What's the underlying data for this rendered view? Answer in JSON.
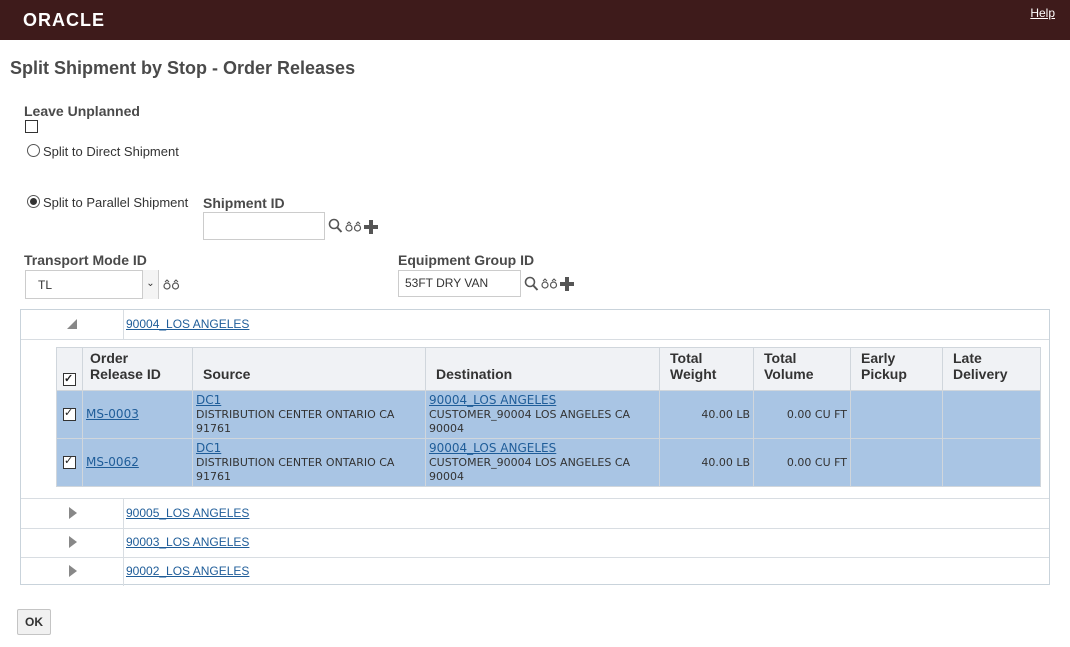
{
  "header": {
    "logo": "ORACLE",
    "help": "Help"
  },
  "page_title": "Split Shipment by Stop - Order Releases",
  "form": {
    "leave_unplanned_label": "Leave Unplanned",
    "leave_unplanned_checked": false,
    "split_direct_label": "Split to Direct Shipment",
    "split_parallel_label": "Split to Parallel Shipment",
    "selected_option": "split_parallel",
    "shipment_id_label": "Shipment ID",
    "shipment_id_value": "",
    "transport_mode_label": "Transport Mode ID",
    "transport_mode_value": "TL",
    "equipment_group_label": "Equipment Group ID",
    "equipment_group_value": "53FT DRY VAN"
  },
  "groups": [
    {
      "name": "90004_LOS ANGELES",
      "expanded": true
    },
    {
      "name": "90005_LOS ANGELES",
      "expanded": false
    },
    {
      "name": "90003_LOS ANGELES",
      "expanded": false
    },
    {
      "name": "90002_LOS ANGELES",
      "expanded": false
    }
  ],
  "table": {
    "headers": {
      "order_release_id": "Order Release ID",
      "source": "Source",
      "destination": "Destination",
      "total_weight": "Total Weight",
      "total_volume": "Total Volume",
      "early_pickup": "Early Pickup",
      "late_delivery": "Late Delivery"
    },
    "rows": [
      {
        "checked": true,
        "order_release_id": "MS-0003",
        "source_link": "DC1",
        "source_text": "DISTRIBUTION CENTER ONTARIO CA 91761",
        "destination_link": "90004_LOS ANGELES",
        "destination_text": "CUSTOMER_90004 LOS ANGELES CA 90004",
        "total_weight": "40.00 LB",
        "total_volume": "0.00 CU FT",
        "early_pickup": "",
        "late_delivery": ""
      },
      {
        "checked": true,
        "order_release_id": "MS-0062",
        "source_link": "DC1",
        "source_text": "DISTRIBUTION CENTER ONTARIO CA 91761",
        "destination_link": "90004_LOS ANGELES",
        "destination_text": "CUSTOMER_90004 LOS ANGELES CA 90004",
        "total_weight": "40.00 LB",
        "total_volume": "0.00 CU FT",
        "early_pickup": "",
        "late_delivery": ""
      }
    ]
  },
  "ok_label": "OK"
}
